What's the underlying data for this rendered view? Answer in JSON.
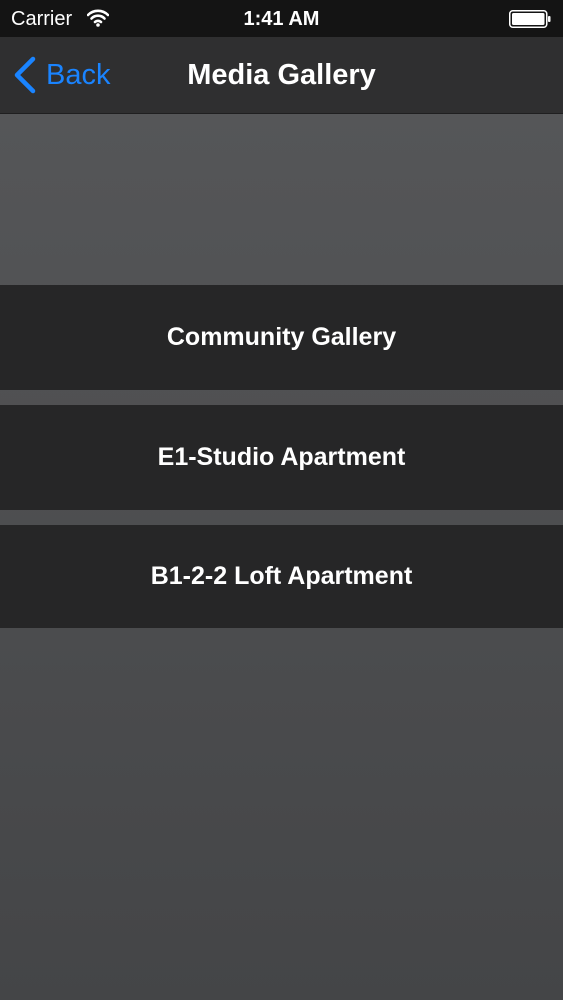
{
  "status_bar": {
    "carrier": "Carrier",
    "time": "1:41 AM",
    "icons": [
      "wifi-icon",
      "battery-icon"
    ]
  },
  "nav": {
    "back_label": "Back",
    "back_icon": "chevron-left-icon",
    "title": "Media Gallery"
  },
  "menu": {
    "items": [
      {
        "label": "Community Gallery"
      },
      {
        "label": "E1-Studio Apartment"
      },
      {
        "label": "B1-2-2 Loft Apartment"
      }
    ]
  },
  "colors": {
    "accent": "#1a84ff",
    "row_background": "#262627",
    "nav_background": "#2f2f30",
    "page_background": "#4a4b4d"
  }
}
